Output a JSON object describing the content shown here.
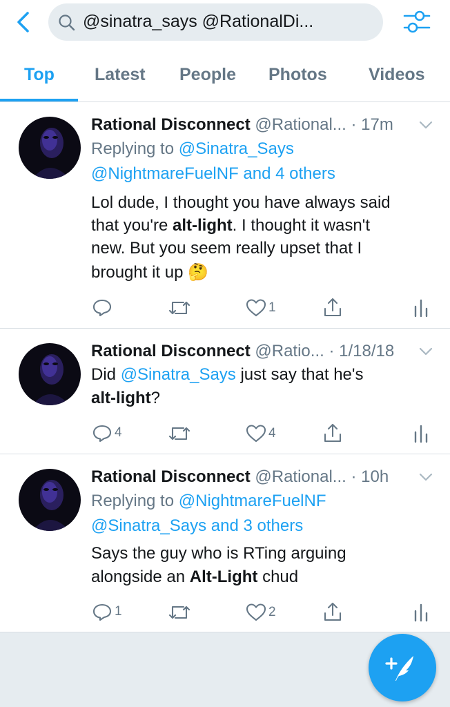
{
  "header": {
    "search_query": "@sinatra_says @RationalDi..."
  },
  "tabs": [
    {
      "label": "Top",
      "active": true
    },
    {
      "label": "Latest",
      "active": false
    },
    {
      "label": "People",
      "active": false
    },
    {
      "label": "Photos",
      "active": false
    },
    {
      "label": "Videos",
      "active": false
    }
  ],
  "tweets": [
    {
      "name": "Rational Disconnect",
      "handle": "@Rational...",
      "time": "· 17m",
      "reply_prefix": "Replying to ",
      "reply_user1": "@Sinatra_Says",
      "reply_user2": "@NightmareFuelNF",
      "reply_and": " and ",
      "reply_others": "4 others",
      "text": {
        "l1": "Lol dude, I thought you have always said",
        "l2a": "that you're ",
        "l2b": "alt-light",
        "l2c": ". I thought it wasn't",
        "l3": "new. But you seem really upset that I",
        "l4": "brought it up",
        "emoji": "🤔"
      },
      "replies": "",
      "retweets": "",
      "likes": "1"
    },
    {
      "name": "Rational Disconnect",
      "handle": "@Ratio...",
      "time": "· 1/18/18",
      "text": {
        "l1a": "Did ",
        "l1b": "@Sinatra_Says",
        "l1c": " just say that he's",
        "l2a": "alt-light",
        "l2b": "?"
      },
      "replies": "4",
      "retweets": "",
      "likes": "4"
    },
    {
      "name": "Rational Disconnect",
      "handle": "@Rational...",
      "time": "· 10h",
      "reply_prefix": "Replying to ",
      "reply_user1": "@NightmareFuelNF",
      "reply_user2": "@Sinatra_Says",
      "reply_and": " and ",
      "reply_others": "3 others",
      "text": {
        "l1": "Says the guy who is RTing arguing",
        "l2a": "alongside an ",
        "l2b": "Alt-Light",
        "l2c": " chud"
      },
      "replies": "1",
      "retweets": "",
      "likes": "2"
    }
  ],
  "colors": {
    "accent": "#1da1f2",
    "secondary_text": "#657786",
    "background": "#e6ecf0"
  },
  "icons": [
    "back-chevron-icon",
    "search-icon",
    "filter-sliders-icon",
    "reply-icon",
    "retweet-icon",
    "like-heart-icon",
    "share-icon",
    "analytics-icon",
    "compose-tweet-icon"
  ]
}
